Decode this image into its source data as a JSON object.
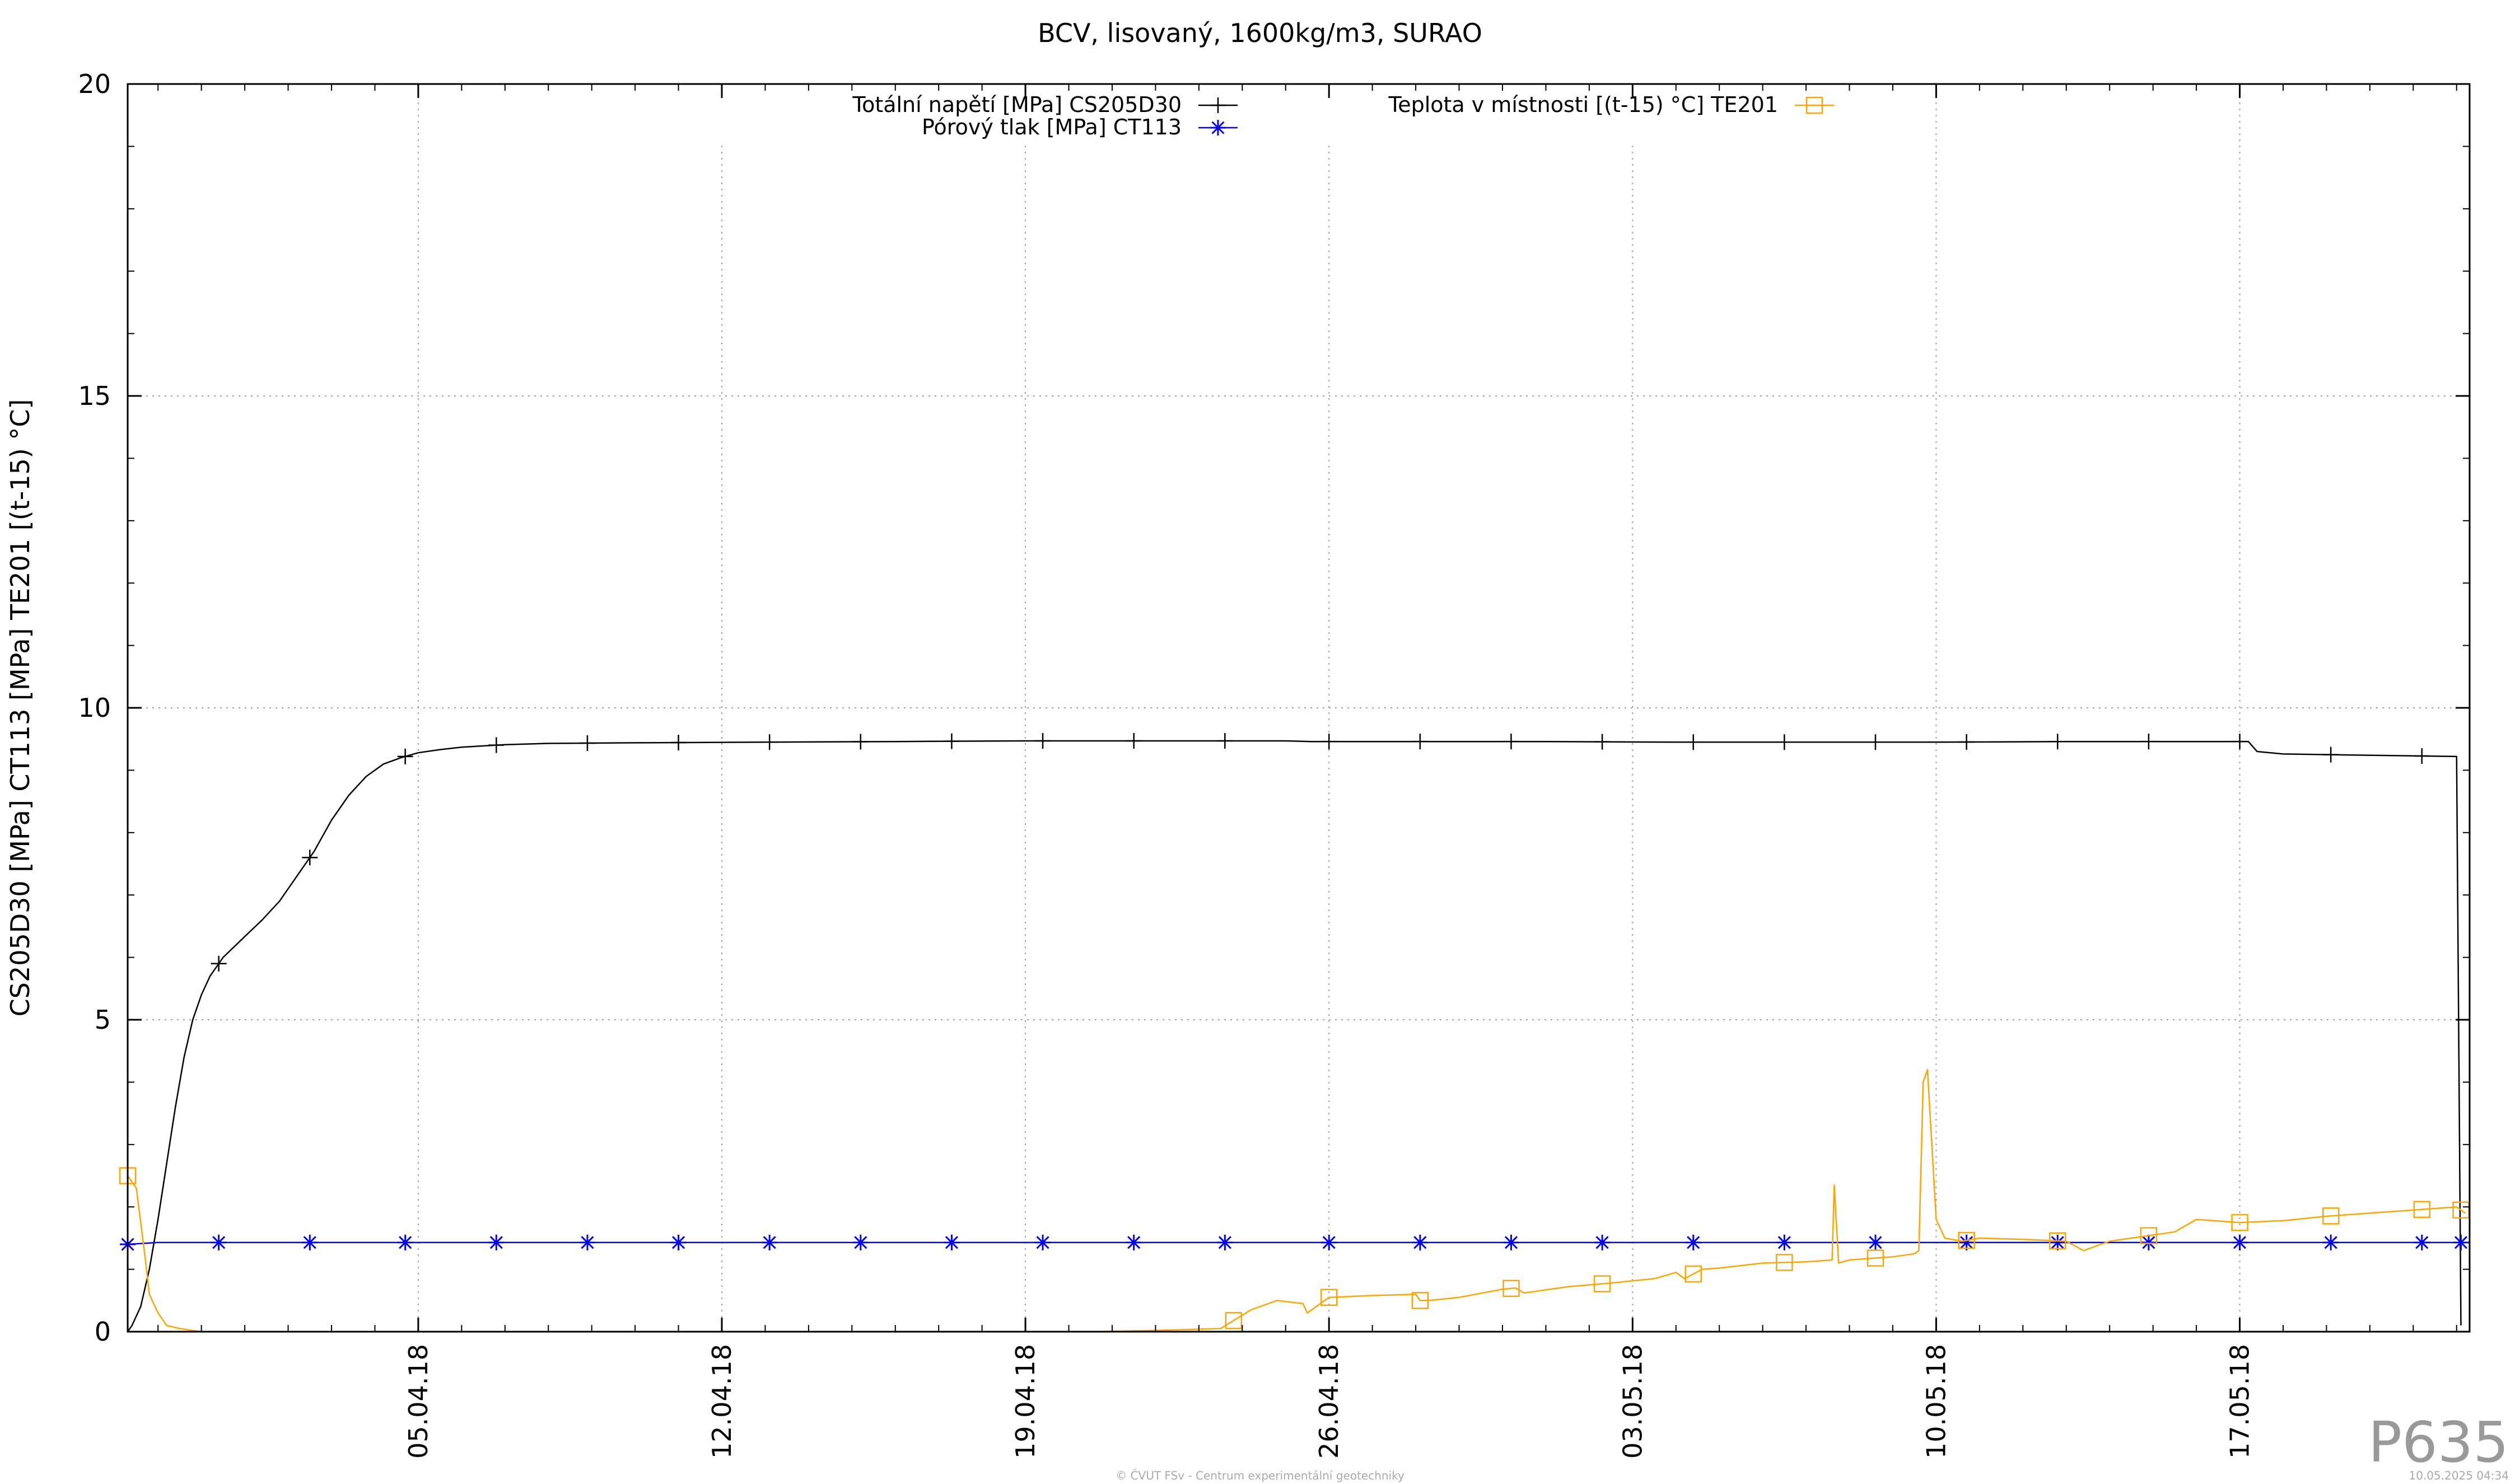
{
  "chart_data": {
    "type": "line",
    "title": "BCV, lisovaný, 1600kg/m3, SURAO",
    "xlabel": "",
    "ylabel": "CS205D30 [MPa] CT113 [MPa] TE201 [(t-15) °C]",
    "ylim": [
      0,
      20
    ],
    "yticks": [
      0,
      5,
      10,
      15,
      20
    ],
    "xlim": [
      -6.7,
      47.3
    ],
    "x_unit": "days relative to 05.04.18",
    "xticks": [
      {
        "x": 0,
        "label": "05.04.18"
      },
      {
        "x": 7,
        "label": "12.04.18"
      },
      {
        "x": 14,
        "label": "19.04.18"
      },
      {
        "x": 21,
        "label": "26.04.18"
      },
      {
        "x": 28,
        "label": "03.05.18"
      },
      {
        "x": 35,
        "label": "10.05.18"
      },
      {
        "x": 42,
        "label": "17.05.18"
      }
    ],
    "grid": true,
    "legend": "top",
    "series": [
      {
        "name": "Totální napětí [MPa] CS205D30",
        "color": "#000000",
        "marker": "plus",
        "x": [
          -6.7,
          -6.6,
          -6.4,
          -6.2,
          -6.0,
          -5.8,
          -5.6,
          -5.4,
          -5.2,
          -5.0,
          -4.8,
          -4.5,
          -4.2,
          -3.9,
          -3.6,
          -3.2,
          -2.8,
          -2.4,
          -2.0,
          -1.6,
          -1.2,
          -0.8,
          -0.4,
          0,
          0.5,
          1,
          2,
          3,
          5,
          8,
          11,
          14,
          17,
          20,
          20.6,
          20.7,
          23,
          26,
          29,
          32,
          35,
          38,
          41,
          42.2,
          42.4,
          43,
          46,
          47.0,
          47.1
        ],
        "y": [
          0,
          0.1,
          0.4,
          1.0,
          1.8,
          2.7,
          3.6,
          4.4,
          5.0,
          5.4,
          5.7,
          6.0,
          6.2,
          6.4,
          6.6,
          6.9,
          7.3,
          7.7,
          8.2,
          8.6,
          8.9,
          9.1,
          9.2,
          9.28,
          9.33,
          9.37,
          9.41,
          9.43,
          9.44,
          9.45,
          9.46,
          9.47,
          9.47,
          9.47,
          9.46,
          9.46,
          9.46,
          9.46,
          9.45,
          9.45,
          9.45,
          9.46,
          9.46,
          9.46,
          9.3,
          9.26,
          9.23,
          9.22,
          0.1
        ],
        "marker_x": [
          -4.6,
          -2.5,
          -0.3,
          1.8,
          3.9,
          6.0,
          8.1,
          10.2,
          12.3,
          14.4,
          16.5,
          18.6,
          21.0,
          23.1,
          25.2,
          27.3,
          29.4,
          31.5,
          33.6,
          35.7,
          37.8,
          39.9,
          42.0,
          44.1,
          46.2
        ]
      },
      {
        "name": "Pórový tlak [MPa] CT113",
        "color": "#0000ff",
        "marker": "star",
        "x": [
          -6.7,
          -6.0,
          47.1
        ],
        "y": [
          1.4,
          1.43,
          1.43
        ],
        "marker_x": [
          -6.7,
          -4.6,
          -2.5,
          -0.3,
          1.8,
          3.9,
          6.0,
          8.1,
          10.2,
          12.3,
          14.4,
          16.5,
          18.6,
          21.0,
          23.1,
          25.2,
          27.3,
          29.4,
          31.5,
          33.6,
          35.7,
          37.8,
          39.9,
          42.0,
          44.1,
          46.2,
          47.1
        ]
      },
      {
        "name": "Teplota v místnosti [(t-15) °C] TE201",
        "color": "#ffa500",
        "marker": "square",
        "x": [
          -6.7,
          -6.5,
          -6.3,
          -6.2,
          -6.0,
          -5.8,
          -5.5,
          -5.2,
          -5.0,
          15.5,
          17.0,
          18.5,
          19.2,
          19.8,
          20.4,
          20.5,
          21.0,
          22.0,
          23.0,
          23.1,
          23.3,
          24.0,
          25.0,
          25.3,
          25.5,
          26.5,
          27.5,
          28.5,
          29.0,
          29.2,
          29.6,
          30.0,
          31.0,
          32.0,
          32.6,
          32.65,
          32.75,
          33.0,
          34.0,
          34.5,
          34.6,
          34.7,
          34.8,
          35.0,
          35.2,
          35.6,
          36.0,
          37.0,
          38.0,
          38.4,
          38.8,
          39.0,
          40.0,
          40.5,
          41.0,
          42.0,
          43.0,
          44.0,
          45.0,
          46.0,
          47.0,
          47.2
        ],
        "y": [
          2.5,
          2.3,
          1.2,
          0.6,
          0.3,
          0.1,
          0.05,
          0.02,
          0,
          0,
          0.02,
          0.05,
          0.35,
          0.5,
          0.45,
          0.3,
          0.55,
          0.58,
          0.6,
          0.5,
          0.5,
          0.55,
          0.68,
          0.7,
          0.62,
          0.72,
          0.78,
          0.85,
          0.95,
          0.85,
          1.0,
          1.02,
          1.1,
          1.12,
          1.15,
          2.35,
          1.1,
          1.15,
          1.2,
          1.25,
          1.3,
          4.0,
          4.2,
          1.8,
          1.5,
          1.45,
          1.5,
          1.48,
          1.45,
          1.3,
          1.4,
          1.45,
          1.55,
          1.6,
          1.8,
          1.75,
          1.78,
          1.85,
          1.9,
          1.95,
          2.0,
          1.9
        ],
        "marker_x": [
          -6.7,
          18.8,
          21.0,
          23.1,
          25.2,
          27.3,
          29.4,
          31.5,
          33.6,
          35.7,
          37.8,
          39.9,
          42.0,
          44.1,
          46.2,
          47.1
        ]
      }
    ]
  },
  "footer": {
    "plot_id": "P635",
    "copyright": "© ČVUT FSv - Centrum experimentální geotechniky",
    "timestamp": "10.05.2025 04:34"
  }
}
